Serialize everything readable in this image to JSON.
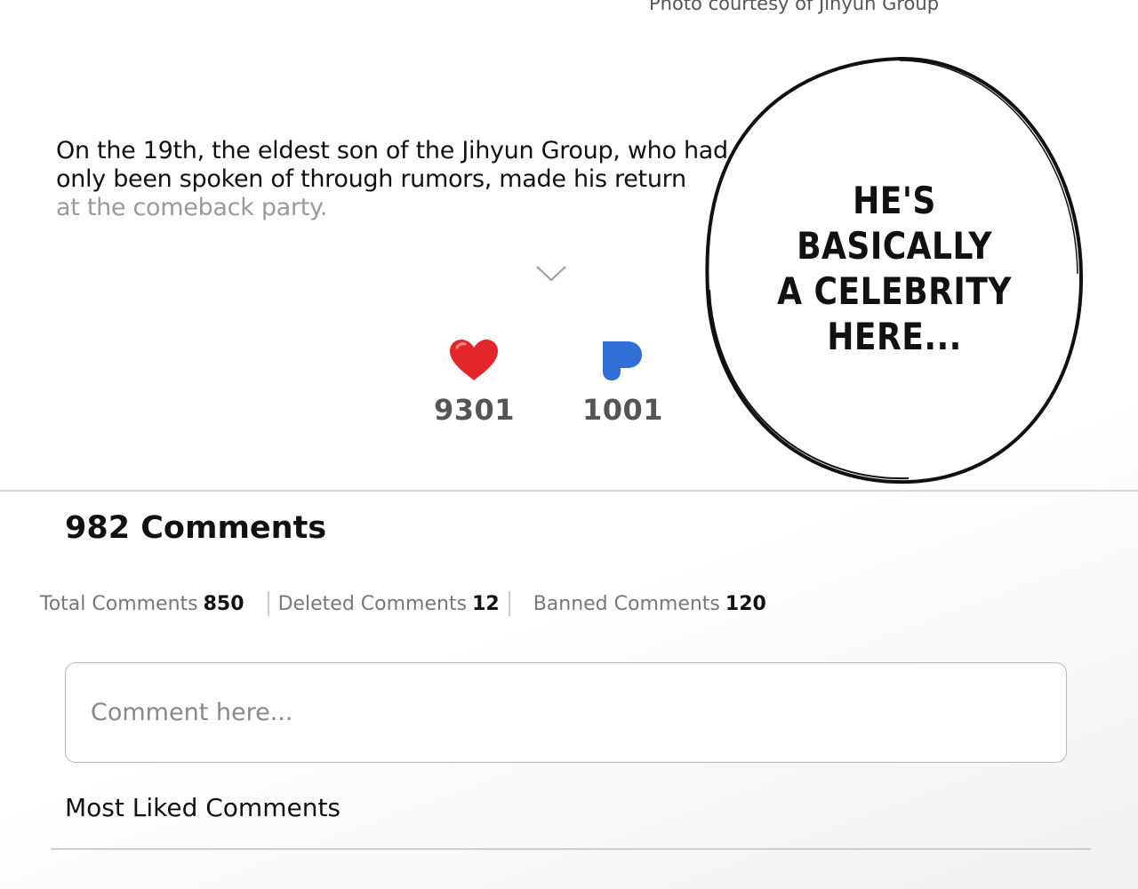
{
  "header": {
    "photo_caption": "Photo courtesy of Jihyun Group"
  },
  "article": {
    "lines": [
      "On the 19th, the eldest son of the Jihyun Group, who had",
      "only been spoken of through rumors, made his return",
      "at the comeback party."
    ]
  },
  "expand_icon": "chevron-down-icon",
  "reactions": {
    "likes": {
      "icon": "heart-icon",
      "count": "9301",
      "color": "#e3262b"
    },
    "bookmarks": {
      "icon": "bookmark-p-icon",
      "count": "1001",
      "color": "#2f6fd6"
    }
  },
  "speech_bubble": {
    "lines": [
      "HE'S",
      "BASICALLY",
      "A CELEBRITY",
      "HERE..."
    ]
  },
  "comments": {
    "title": "982 Comments",
    "stats": [
      {
        "label": "Total Comments",
        "value": "850"
      },
      {
        "label": "Deleted Comments",
        "value": "12"
      },
      {
        "label": "Banned Comments",
        "value": "120"
      }
    ],
    "input_placeholder": "Comment here...",
    "most_liked_label": "Most Liked Comments"
  }
}
